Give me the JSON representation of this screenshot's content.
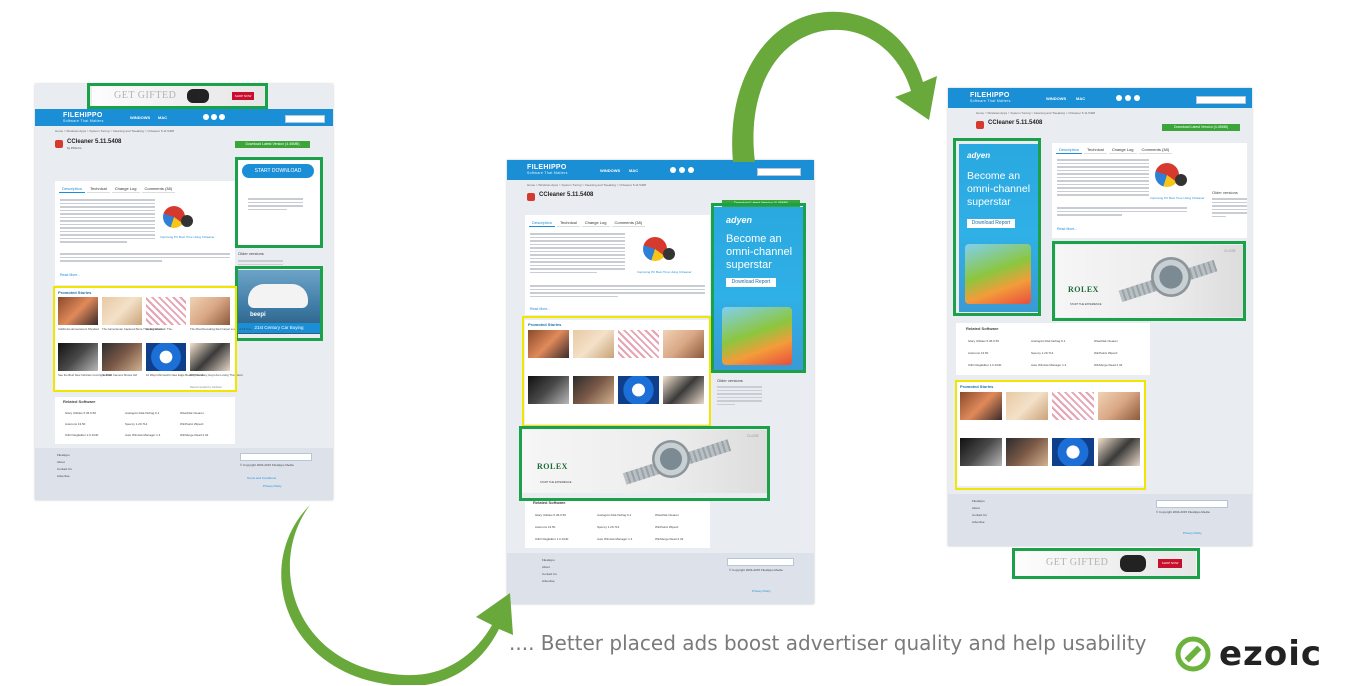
{
  "site": {
    "logo": "FILEHIPPO",
    "logo_tagline": "Software That Matters",
    "nav": [
      "WINDOWS",
      "MAC"
    ],
    "news": "NEWS",
    "lang": "English"
  },
  "breadcrumb": "Home > Windows Apps > System Tuning > Cleaning and Tweaking > CCleaner 5.11.5408",
  "app": {
    "title": "CCleaner 5.11.5408",
    "byline": "by Piriform",
    "rating_label": "User Rating",
    "download_button": "Download Latest Version (4.45MB)"
  },
  "tabs": [
    "Description",
    "Technical",
    "Change Log",
    "Comments (38)"
  ],
  "video_caption": "Improving PC Boot Time Using CCleaner",
  "read_more": "Read More...",
  "sidebar": {
    "start_download": "START DOWNLOAD",
    "older_versions_title": "Older versions",
    "older_versions": [
      "CCleaner 5.10.5373",
      "CCleaner 5.09.5343",
      "CCleaner 5.08.5308",
      "CCleaner 5.07.5261",
      "CCleaner 5.06.5219"
    ],
    "view_more": "View more"
  },
  "promoted": {
    "title": "Promoted Stories",
    "stories": [
      "California Homeowners Shocked",
      "The Cameraman Captured More Than Expected",
      "Heavy Wet Hair: The...",
      "The Most Revealing Red Carpet Looks of All Time",
      "See the Best New Vehicles Coming in 2016",
      "German Camera Shows Girl",
      "10 Ways Microsoft's New Edge Beats Chrome",
      "Why So Many Guys Are Loving This Razor"
    ],
    "recommended_by": "Recommended by Outbrain"
  },
  "related": {
    "title": "Related Software",
    "items": [
      "Glary Utilities 5.36.0.56",
      "Auslogics Disk Defrag 6.1",
      "WiseDisk Cleaner",
      "Autoruns 13.50",
      "Speccy 1.29.714",
      "WinPatrol Wiperd",
      "O&O RegEditor 1.0.1040",
      "Auto Window Manager 1.4",
      "WinMerge Read 2.32"
    ]
  },
  "footer": {
    "links": [
      "FileHippo",
      "About",
      "Contact Us",
      "Advertise"
    ],
    "search_placeholder": "Search for anything...",
    "copyright": "© Copyright 2004-2015 FileHippo Media",
    "rights": "All rights reserved.",
    "terms": "Terms and Conditions",
    "cookie": "Cookie Policy",
    "privacy": "Privacy Policy"
  },
  "ads": {
    "gifted": "GET GIFTED",
    "gifted_button": "SHOP NOW",
    "car_caption": "21st Century Car Buying",
    "car_brand": "beepi",
    "adyen_logo": "adyen",
    "adyen_headline": "Become an omni-channel superstar",
    "adyen_button": "Download Report",
    "rolex": "ROLEX",
    "rolex_sub": "START THE EXPERIENCE",
    "rolex_close": "CLOSE"
  },
  "tagline": ".... Better placed ads boost advertiser quality and help usability",
  "brand": "ezoic",
  "colors": {
    "highlight_ad": "#1aa14a",
    "highlight_content": "#f2e500",
    "arrow": "#69a83a",
    "site_blue": "#1b8fd6"
  }
}
